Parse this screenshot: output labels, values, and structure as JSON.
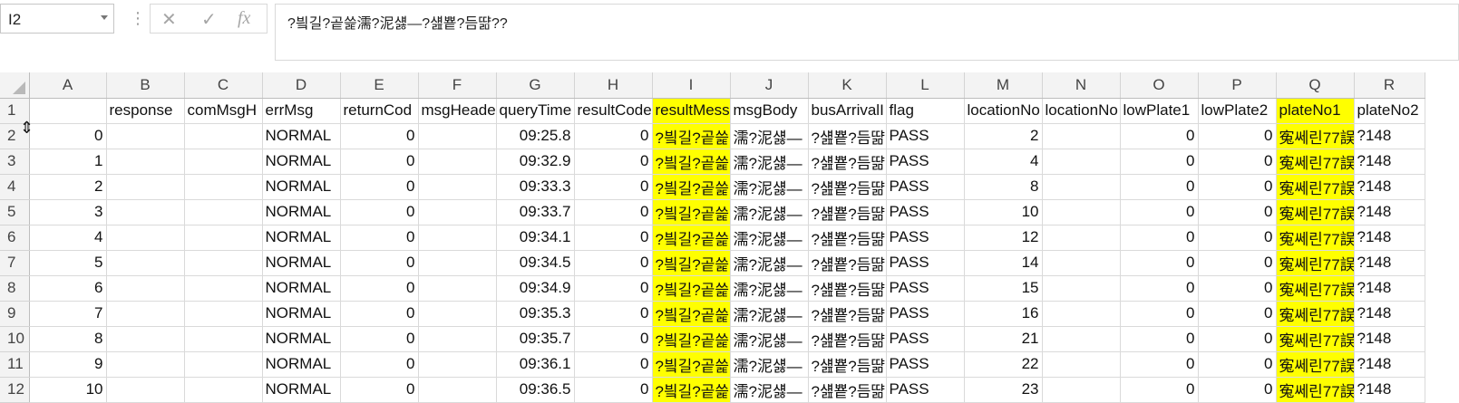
{
  "name_box": {
    "value": "I2"
  },
  "formula_bar": {
    "cancel_icon": "✕",
    "enter_icon": "✓",
    "fx_label": "fx",
    "value": "?빀길?곹쓽濡?泥섏—?섎뿉?듬땲??"
  },
  "columns": [
    "A",
    "B",
    "C",
    "D",
    "E",
    "F",
    "G",
    "H",
    "I",
    "J",
    "K",
    "L",
    "M",
    "N",
    "O",
    "P",
    "Q",
    "R"
  ],
  "highlight_color": "#ffff00",
  "rows": [
    {
      "num": "1",
      "cells": [
        "",
        "response",
        "comMsgH",
        "errMsg",
        "returnCod",
        "msgHeade",
        "queryTime",
        "resultCode",
        "resultMess",
        "msgBody",
        "busArrivalI",
        "flag",
        "locationNo",
        "locationNo",
        "lowPlate1",
        "lowPlate2",
        "plateNo1",
        "plateNo2"
      ]
    },
    {
      "num": "2",
      "cells": [
        "0",
        "",
        "",
        "NORMAL",
        "0",
        "",
        "09:25.8",
        "0",
        "?빀길?곹쓽",
        "濡?泥섏—",
        "?섎뿉?듬땲",
        "PASS",
        "2",
        "",
        "0",
        "0",
        "寃쎄린77誤",
        "?148"
      ]
    },
    {
      "num": "3",
      "cells": [
        "1",
        "",
        "",
        "NORMAL",
        "0",
        "",
        "09:32.9",
        "0",
        "?빀길?곹쓽",
        "濡?泥섏—",
        "?섎뿉?듬땲",
        "PASS",
        "4",
        "",
        "0",
        "0",
        "寃쎄린77誤",
        "?148"
      ]
    },
    {
      "num": "4",
      "cells": [
        "2",
        "",
        "",
        "NORMAL",
        "0",
        "",
        "09:33.3",
        "0",
        "?빀길?곹쓽",
        "濡?泥섏—",
        "?섎뿉?듬땲",
        "PASS",
        "8",
        "",
        "0",
        "0",
        "寃쎄린77誤",
        "?148"
      ]
    },
    {
      "num": "5",
      "cells": [
        "3",
        "",
        "",
        "NORMAL",
        "0",
        "",
        "09:33.7",
        "0",
        "?빀길?곹쓽",
        "濡?泥섏—",
        "?섎뿉?듬땲",
        "PASS",
        "10",
        "",
        "0",
        "0",
        "寃쎄린77誤",
        "?148"
      ]
    },
    {
      "num": "6",
      "cells": [
        "4",
        "",
        "",
        "NORMAL",
        "0",
        "",
        "09:34.1",
        "0",
        "?빀길?곹쓽",
        "濡?泥섏—",
        "?섎뿉?듬땲",
        "PASS",
        "12",
        "",
        "0",
        "0",
        "寃쎄린77誤",
        "?148"
      ]
    },
    {
      "num": "7",
      "cells": [
        "5",
        "",
        "",
        "NORMAL",
        "0",
        "",
        "09:34.5",
        "0",
        "?빀길?곹쓽",
        "濡?泥섏—",
        "?섎뿉?듬땲",
        "PASS",
        "14",
        "",
        "0",
        "0",
        "寃쎄린77誤",
        "?148"
      ]
    },
    {
      "num": "8",
      "cells": [
        "6",
        "",
        "",
        "NORMAL",
        "0",
        "",
        "09:34.9",
        "0",
        "?빀길?곹쓽",
        "濡?泥섏—",
        "?섎뿉?듬땲",
        "PASS",
        "15",
        "",
        "0",
        "0",
        "寃쎄린77誤",
        "?148"
      ]
    },
    {
      "num": "9",
      "cells": [
        "7",
        "",
        "",
        "NORMAL",
        "0",
        "",
        "09:35.3",
        "0",
        "?빀길?곹쓽",
        "濡?泥섏—",
        "?섎뿉?듬땲",
        "PASS",
        "16",
        "",
        "0",
        "0",
        "寃쎄린77誤",
        "?148"
      ]
    },
    {
      "num": "10",
      "cells": [
        "8",
        "",
        "",
        "NORMAL",
        "0",
        "",
        "09:35.7",
        "0",
        "?빀길?곹쓽",
        "濡?泥섏—",
        "?섎뿉?듬땲",
        "PASS",
        "21",
        "",
        "0",
        "0",
        "寃쎄린77誤",
        "?148"
      ]
    },
    {
      "num": "11",
      "cells": [
        "9",
        "",
        "",
        "NORMAL",
        "0",
        "",
        "09:36.1",
        "0",
        "?빀길?곹쓽",
        "濡?泥섏—",
        "?섎뿉?듬땲",
        "PASS",
        "22",
        "",
        "0",
        "0",
        "寃쎄린77誤",
        "?148"
      ]
    },
    {
      "num": "12",
      "cells": [
        "10",
        "",
        "",
        "NORMAL",
        "0",
        "",
        "09:36.5",
        "0",
        "?빀길?곹쓽",
        "濡?泥섏—",
        "?섎뿉?듬땲",
        "PASS",
        "23",
        "",
        "0",
        "0",
        "寃쎄린77誤",
        "?148"
      ]
    }
  ]
}
